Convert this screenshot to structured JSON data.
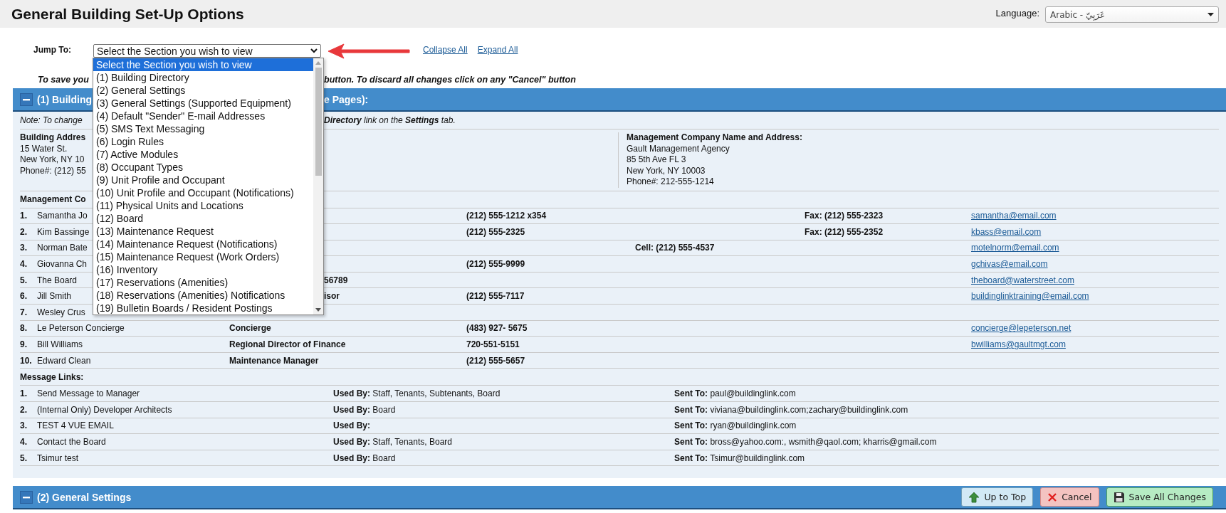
{
  "header": {
    "title": "General Building Set-Up Options",
    "language_label": "Language:",
    "language_value": "Arabic - عَرَبِيّ"
  },
  "jump": {
    "label": "Jump To:",
    "value": "Select the Section you wish to view",
    "links": [
      "Collapse All",
      "Expand All"
    ],
    "options": [
      {
        "label": "Select the Section you wish to view",
        "selected": true
      },
      {
        "label": "(1) Building Directory",
        "selected": false
      },
      {
        "label": "(2) General Settings",
        "selected": false
      },
      {
        "label": "(3) General Settings (Supported Equipment)",
        "selected": false
      },
      {
        "label": "(4) Default \"Sender\" E-mail Addresses",
        "selected": false
      },
      {
        "label": "(5) SMS Text Messaging",
        "selected": false
      },
      {
        "label": "(6) Login Rules",
        "selected": false
      },
      {
        "label": "(7) Active Modules",
        "selected": false
      },
      {
        "label": "(8) Occupant Types",
        "selected": false
      },
      {
        "label": "(9) Unit Profile and Occupant",
        "selected": false
      },
      {
        "label": "(10) Unit Profile and Occupant (Notifications)",
        "selected": false
      },
      {
        "label": "(11) Physical Units and Locations",
        "selected": false
      },
      {
        "label": "(12) Board",
        "selected": false
      },
      {
        "label": "(13) Maintenance Request",
        "selected": false
      },
      {
        "label": "(14) Maintenance Request (Notifications)",
        "selected": false
      },
      {
        "label": "(15) Maintenance Request (Work Orders)",
        "selected": false
      },
      {
        "label": "(16) Inventory",
        "selected": false
      },
      {
        "label": "(17) Reservations (Amenities)",
        "selected": false
      },
      {
        "label": "(18) Reservations (Amenities) Notifications",
        "selected": false
      },
      {
        "label": "(19) Bulletin Boards / Resident Postings",
        "selected": false
      }
    ]
  },
  "instructions": {
    "head": "To save you",
    "tail": "button. To discard all changes click on any \"Cancel\" button"
  },
  "sections": [
    {
      "kind": "directory",
      "title": "(1) Building",
      "title_tail": "e Pages):",
      "expanded": true,
      "note": "Note: To change",
      "note_tail": "**Directory** link on the **Settings** tab.",
      "building_address": {
        "label": "Building Addres",
        "lines": [
          "15 Water St.",
          "New York, NY 10",
          "Phone#: (212) 55"
        ]
      },
      "company_address": {
        "label": "Management Company Name and Address:",
        "lines": [
          "Gault Management Agency",
          "85 5th Ave FL 3",
          "New York, NY 10003",
          "Phone#: 212-555-1214"
        ]
      },
      "contacts_label": "Management Co",
      "contacts": [
        {
          "number": "1.",
          "name": "Samantha Jo",
          "phone": "(212) 555-1212 x354",
          "fax": "Fax: (212) 555-2323",
          "email": "samantha@email.com"
        },
        {
          "number": "2.",
          "name": "Kim Bassinge",
          "phone": "(212) 555-2325",
          "fax": "Fax: (212) 555-2352",
          "email": "kbass@email.com"
        },
        {
          "number": "3.",
          "name": "Norman Bate",
          "cell": "Cell: (212) 555-4537",
          "email": "motelnorm@email.com"
        },
        {
          "number": "4.",
          "name": "Giovanna Ch",
          "phone": "(212) 555-9999",
          "email": "gchivas@email.com"
        },
        {
          "number": "5.",
          "name": "The Board",
          "title_tail": "56789",
          "email": "theboard@waterstreet.com"
        },
        {
          "number": "6.",
          "name": "Jill Smith",
          "title_tail": "isor",
          "phone": "(212) 555-7117",
          "email": "buildinglinktraining@email.com"
        },
        {
          "number": "7.",
          "name": "Wesley Crus"
        },
        {
          "number": "8.",
          "name": "Le Peterson Concierge",
          "title": "Concierge",
          "phone": "(483) 927- 5675",
          "email": "concierge@lepeterson.net"
        },
        {
          "number": "9.",
          "name": "Bill Williams",
          "title": "Regional Director of Finance",
          "phone": "720-551-5151",
          "email": "bwilliams@gaultmgt.com"
        },
        {
          "number": "10.",
          "name": "Edward Clean",
          "title": "Maintenance Manager",
          "phone": "(212) 555-5657"
        }
      ],
      "messages_label": "Message Links:",
      "messages": [
        {
          "number": "1.",
          "name": "Send Message to Manager",
          "used_by": "**Used By:** Staff, Tenants, Subtenants, Board",
          "sent_to": "**Sent To:** paul@buildinglink.com"
        },
        {
          "number": "2.",
          "name": "(Internal Only) Developer Architects",
          "used_by": "**Used By:** Board",
          "sent_to": "**Sent To:** viviana@buildinglink.com;zachary@buildinglink.com"
        },
        {
          "number": "3.",
          "name": "TEST 4 VUE EMAIL",
          "used_by": "**Used By:**",
          "sent_to": "**Sent To:** ryan@buildinglink.com"
        },
        {
          "number": "4.",
          "name": "Contact the Board",
          "used_by": "**Used By:** Staff, Tenants, Board",
          "sent_to": "**Sent To:** bross@yahoo.com:, wsmith@qaol.com; kharris@gmail.com"
        },
        {
          "number": "5.",
          "name": "Tsimur test",
          "used_by": "**Used By:** Board",
          "sent_to": "**Sent To:** Tsimur@buildinglink.com"
        }
      ]
    },
    {
      "kind": "settings",
      "title": "(2) General Settings",
      "expanded": true,
      "buttons": [
        {
          "kind": "top",
          "label": "Up to Top"
        },
        {
          "kind": "cancel",
          "label": "Cancel"
        },
        {
          "kind": "save",
          "label": "Save All Changes"
        }
      ]
    }
  ]
}
